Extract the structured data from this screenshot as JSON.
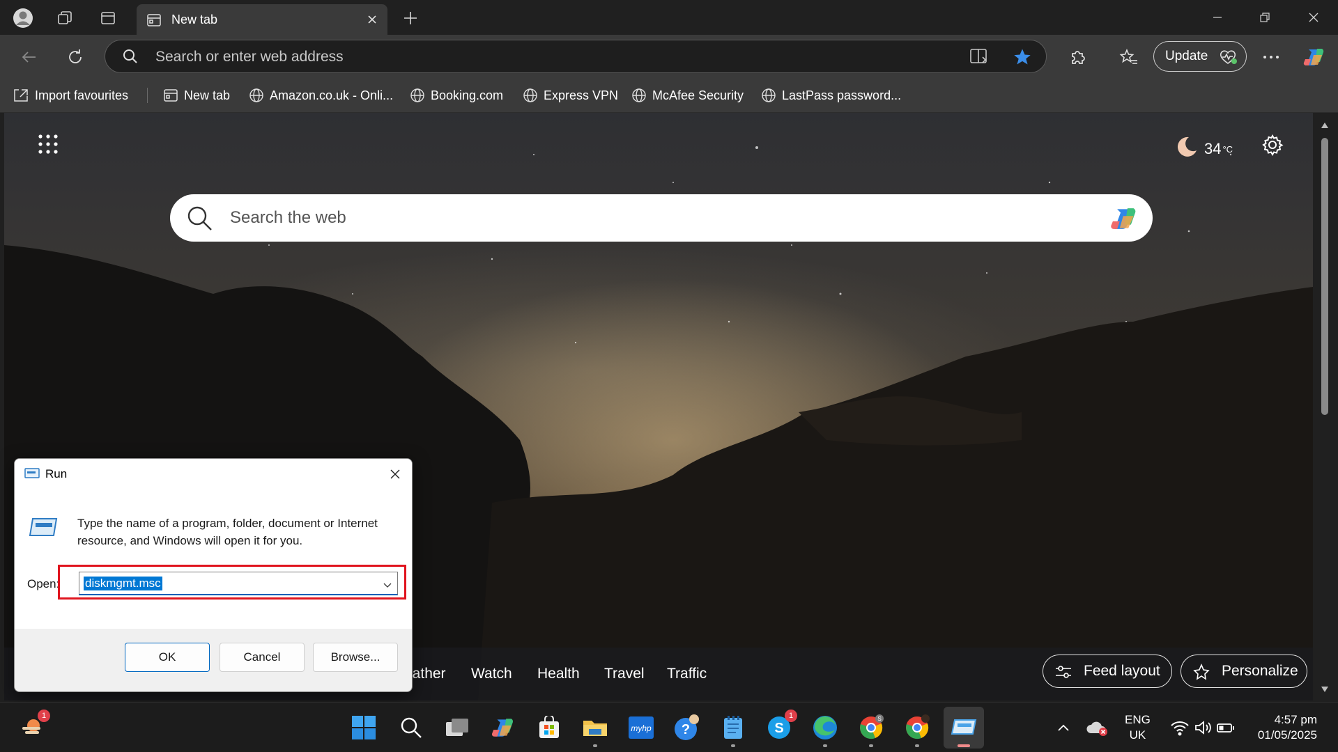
{
  "browser": {
    "tab_title": "New tab",
    "address_placeholder": "Search or enter web address",
    "update_label": "Update"
  },
  "bookmarks": [
    {
      "label": "Import favourites"
    },
    {
      "label": "New tab"
    },
    {
      "label": "Amazon.co.uk - Onli..."
    },
    {
      "label": "Booking.com"
    },
    {
      "label": "Express VPN"
    },
    {
      "label": "McAfee Security"
    },
    {
      "label": "LastPass password..."
    }
  ],
  "ntp": {
    "search_placeholder": "Search the web",
    "weather_temp": "34",
    "weather_unit": "°C",
    "feed_links": [
      "eather",
      "Watch",
      "Health",
      "Travel",
      "Traffic"
    ],
    "feed_layout_label": "Feed layout",
    "personalize_label": "Personalize"
  },
  "run_dialog": {
    "title": "Run",
    "description": "Type the name of a program, folder, document or Internet resource, and Windows will open it for you.",
    "open_label": "Open:",
    "open_value": "diskmgmt.msc",
    "ok_label": "OK",
    "cancel_label": "Cancel",
    "browse_label": "Browse..."
  },
  "taskbar": {
    "weather_badge": "1",
    "skype_badge": "1",
    "language_line1": "ENG",
    "language_line2": "UK",
    "time": "4:57 pm",
    "date": "01/05/2025"
  },
  "colors": {
    "highlight": "#e0141e",
    "selection": "#0078d4",
    "accent_star": "#3b8eea"
  }
}
